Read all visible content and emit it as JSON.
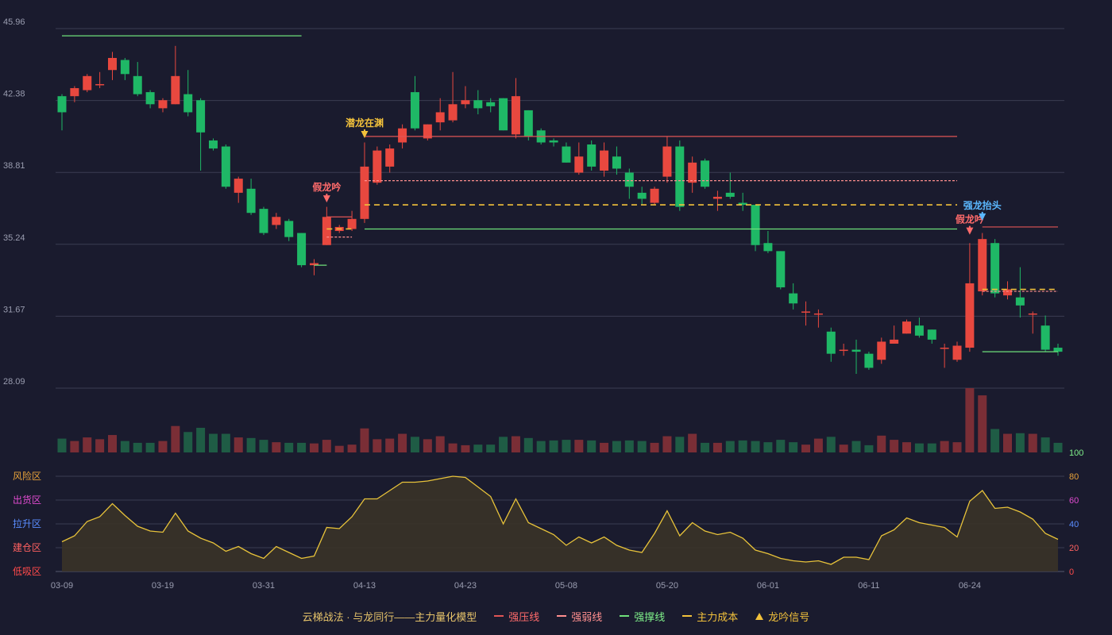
{
  "chart_data": {
    "type": "candlestick",
    "colors": {
      "up": "#e8483f",
      "down": "#1fb866",
      "pressure": "#e05555",
      "weak": "#ff8f8f",
      "support": "#6ee07a",
      "cost": "#f2c13b",
      "grid": "#3a3c52",
      "axis": "#9a9db0",
      "line": "#e8c33a",
      "signal_fake": "#ff6b6b",
      "signal_dragon": "#f2c13b",
      "signal_strong": "#5bb8ff"
    },
    "price_axis": {
      "min": 28.09,
      "max": 45.96,
      "ticks": [
        "45.96",
        "42.38",
        "38.81",
        "35.24",
        "31.67",
        "28.09"
      ]
    },
    "osc_axis": {
      "min": 0,
      "max": 100,
      "ticks": [
        "100",
        "80",
        "60",
        "40",
        "20",
        "0"
      ]
    },
    "zones": [
      "风险区",
      "出货区",
      "拉升区",
      "建仓区",
      "低吸区"
    ],
    "zone_colors": [
      "#e6a13a",
      "#e04bd0",
      "#5a8dff",
      "#ff6060",
      "#ff4a4a"
    ],
    "x_tick_labels": [
      {
        "i": 0,
        "label": "03-09"
      },
      {
        "i": 8,
        "label": "03-19"
      },
      {
        "i": 16,
        "label": "03-31"
      },
      {
        "i": 24,
        "label": "04-13"
      },
      {
        "i": 32,
        "label": "04-23"
      },
      {
        "i": 40,
        "label": "05-08"
      },
      {
        "i": 48,
        "label": "05-20"
      },
      {
        "i": 56,
        "label": "06-01"
      },
      {
        "i": 64,
        "label": "06-11"
      },
      {
        "i": 72,
        "label": "06-24"
      }
    ],
    "candles": [
      [
        42.6,
        41.8,
        42.7,
        40.9
      ],
      [
        42.6,
        43.0,
        43.1,
        42.3
      ],
      [
        42.9,
        43.6,
        43.7,
        42.8
      ],
      [
        43.2,
        43.2,
        43.8,
        43.0
      ],
      [
        43.9,
        44.5,
        44.8,
        43.4
      ],
      [
        44.4,
        43.7,
        44.5,
        43.4
      ],
      [
        43.6,
        42.7,
        44.3,
        42.6
      ],
      [
        42.8,
        42.2,
        42.9,
        42.0
      ],
      [
        42.0,
        42.4,
        42.5,
        41.8
      ],
      [
        42.2,
        43.6,
        45.1,
        42.2
      ],
      [
        42.7,
        41.8,
        43.9,
        41.6
      ],
      [
        42.4,
        40.8,
        42.5,
        38.9
      ],
      [
        40.4,
        40.0,
        40.5,
        39.9
      ],
      [
        40.1,
        38.1,
        40.2,
        38.0
      ],
      [
        37.8,
        38.5,
        38.6,
        37.3
      ],
      [
        38.0,
        36.8,
        38.5,
        36.7
      ],
      [
        37.0,
        35.8,
        37.1,
        35.7
      ],
      [
        36.2,
        36.6,
        36.8,
        36.0
      ],
      [
        36.4,
        35.6,
        36.5,
        35.4
      ],
      [
        35.8,
        34.2,
        35.8,
        34.1
      ],
      [
        34.2,
        34.3,
        34.5,
        33.7
      ],
      [
        35.2,
        36.6,
        37.1,
        35.2
      ],
      [
        35.9,
        36.1,
        36.2,
        35.8
      ],
      [
        36.0,
        36.5,
        36.9,
        35.9
      ],
      [
        36.5,
        39.1,
        40.3,
        36.3
      ],
      [
        38.3,
        39.9,
        40.1,
        38.2
      ],
      [
        39.1,
        40.0,
        40.2,
        38.8
      ],
      [
        40.3,
        41.0,
        41.2,
        40.0
      ],
      [
        42.8,
        41.0,
        43.6,
        40.9
      ],
      [
        40.5,
        41.2,
        41.2,
        40.4
      ],
      [
        41.3,
        41.8,
        42.5,
        40.9
      ],
      [
        41.4,
        42.2,
        43.8,
        41.3
      ],
      [
        42.2,
        42.4,
        43.1,
        42.0
      ],
      [
        42.4,
        42.0,
        42.9,
        41.7
      ],
      [
        42.3,
        42.1,
        42.5,
        41.8
      ],
      [
        42.5,
        40.9,
        42.5,
        40.9
      ],
      [
        40.7,
        42.6,
        43.5,
        40.5
      ],
      [
        41.9,
        40.6,
        41.9,
        40.4
      ],
      [
        40.9,
        40.3,
        41.0,
        40.2
      ],
      [
        40.4,
        40.3,
        40.5,
        40.1
      ],
      [
        40.1,
        39.3,
        40.3,
        39.3
      ],
      [
        38.8,
        39.6,
        40.3,
        38.7
      ],
      [
        40.2,
        39.1,
        40.4,
        38.9
      ],
      [
        38.9,
        39.9,
        40.3,
        38.6
      ],
      [
        39.6,
        39.0,
        40.1,
        38.7
      ],
      [
        38.8,
        38.1,
        39.0,
        37.5
      ],
      [
        37.8,
        37.5,
        38.1,
        37.2
      ],
      [
        37.3,
        38.0,
        38.1,
        37.2
      ],
      [
        38.6,
        40.1,
        40.6,
        38.3
      ],
      [
        40.1,
        37.1,
        40.4,
        36.9
      ],
      [
        38.3,
        39.3,
        39.6,
        37.8
      ],
      [
        39.4,
        38.1,
        39.5,
        38.0
      ],
      [
        37.5,
        37.6,
        37.9,
        36.9
      ],
      [
        37.8,
        37.6,
        38.8,
        37.5
      ],
      [
        37.3,
        37.2,
        37.8,
        36.9
      ],
      [
        37.2,
        35.2,
        37.2,
        34.9
      ],
      [
        35.3,
        34.9,
        35.9,
        34.8
      ],
      [
        34.9,
        33.1,
        34.9,
        33.0
      ],
      [
        32.8,
        32.3,
        33.3,
        32.0
      ],
      [
        31.9,
        31.9,
        32.4,
        31.2
      ],
      [
        31.8,
        31.8,
        32.0,
        31.1
      ],
      [
        30.9,
        29.8,
        31.1,
        29.4
      ],
      [
        30.0,
        30.0,
        30.3,
        29.7
      ],
      [
        30.0,
        29.9,
        30.5,
        28.8
      ],
      [
        29.8,
        29.1,
        29.9,
        29.0
      ],
      [
        29.5,
        30.4,
        30.6,
        29.3
      ],
      [
        30.3,
        30.5,
        31.2,
        30.3
      ],
      [
        30.8,
        31.4,
        31.5,
        30.8
      ],
      [
        31.2,
        30.7,
        31.6,
        30.6
      ],
      [
        31.0,
        30.5,
        31.0,
        30.3
      ],
      [
        30.1,
        30.1,
        30.3,
        29.1
      ],
      [
        29.5,
        30.2,
        30.4,
        29.4
      ],
      [
        30.1,
        33.3,
        35.3,
        29.9
      ],
      [
        32.9,
        35.5,
        35.8,
        32.7
      ],
      [
        35.3,
        32.8,
        35.5,
        32.6
      ],
      [
        32.7,
        33.0,
        33.4,
        32.5
      ],
      [
        32.6,
        32.2,
        34.1,
        31.6
      ],
      [
        31.8,
        31.8,
        31.9,
        30.8
      ],
      [
        31.2,
        30.0,
        31.7,
        29.9
      ],
      [
        30.1,
        29.9,
        30.3,
        29.7
      ]
    ],
    "volume": [
      23,
      19,
      25,
      22,
      29,
      19,
      16,
      16,
      19,
      44,
      34,
      41,
      31,
      31,
      25,
      24,
      21,
      17,
      16,
      16,
      15,
      21,
      11,
      13,
      40,
      22,
      23,
      31,
      26,
      22,
      27,
      15,
      12,
      13,
      13,
      26,
      27,
      24,
      19,
      20,
      21,
      21,
      20,
      16,
      19,
      20,
      19,
      16,
      27,
      26,
      31,
      16,
      16,
      19,
      20,
      19,
      17,
      21,
      17,
      13,
      23,
      26,
      13,
      19,
      12,
      28,
      21,
      17,
      15,
      15,
      19,
      17,
      107,
      95,
      39,
      31,
      32,
      31,
      25,
      16
    ],
    "oscillator": [
      25,
      30,
      42,
      46,
      57,
      47,
      38,
      34,
      33,
      49,
      34,
      28,
      24,
      17,
      21,
      15,
      11,
      21,
      16,
      11,
      13,
      37,
      36,
      46,
      61,
      61,
      68,
      75,
      75,
      76,
      78,
      80,
      79,
      71,
      63,
      40,
      61,
      41,
      36,
      31,
      22,
      29,
      24,
      29,
      22,
      18,
      16,
      32,
      51,
      30,
      41,
      34,
      31,
      33,
      28,
      18,
      15,
      11,
      9,
      8,
      9,
      6,
      12,
      12,
      10,
      30,
      35,
      45,
      41,
      39,
      37,
      29,
      59,
      68,
      53,
      54,
      50,
      44,
      32,
      27
    ],
    "lines": [
      {
        "kind": "support",
        "from": 0,
        "to": 19,
        "value": 45.6
      },
      {
        "kind": "support",
        "from": 20,
        "to": 21,
        "value": 34.2
      },
      {
        "kind": "pressure",
        "from": 21,
        "to": 23,
        "value": 36.6
      },
      {
        "kind": "weak",
        "from": 21,
        "to": 23,
        "value": 35.6
      },
      {
        "kind": "cost",
        "from": 21,
        "to": 23,
        "value": 36.0
      },
      {
        "kind": "pressure",
        "from": 24,
        "to": 71,
        "value": 40.6
      },
      {
        "kind": "weak",
        "from": 24,
        "to": 71,
        "value": 38.4
      },
      {
        "kind": "cost",
        "from": 24,
        "to": 71,
        "value": 37.2
      },
      {
        "kind": "support",
        "from": 24,
        "to": 71,
        "value": 36.0
      },
      {
        "kind": "pressure",
        "from": 73,
        "to": 79,
        "value": 36.1
      },
      {
        "kind": "cost",
        "from": 73,
        "to": 79,
        "value": 33.0
      },
      {
        "kind": "weak",
        "from": 73,
        "to": 79,
        "value": 32.9
      },
      {
        "kind": "support",
        "from": 73,
        "to": 79,
        "value": 29.9
      }
    ],
    "signals": [
      {
        "i": 21,
        "label": "假龙吟",
        "kind": "fake",
        "y": 37.2
      },
      {
        "i": 24,
        "label": "潜龙在渊",
        "kind": "dragon",
        "y": 40.4
      },
      {
        "i": 72,
        "label": "假龙吟",
        "kind": "fake",
        "y": 35.6
      },
      {
        "i": 73,
        "label": "强龙抬头",
        "kind": "strong",
        "y": 36.3
      }
    ],
    "legend": [
      {
        "label": "云梯战法 · 与龙同行——主力量化模型",
        "kind": "title"
      },
      {
        "label": "强压线",
        "kind": "pressure"
      },
      {
        "label": "强弱线",
        "kind": "weak"
      },
      {
        "label": "强撑线",
        "kind": "support"
      },
      {
        "label": "主力成本",
        "kind": "cost"
      },
      {
        "label": "龙吟信号",
        "kind": "signal"
      }
    ]
  }
}
